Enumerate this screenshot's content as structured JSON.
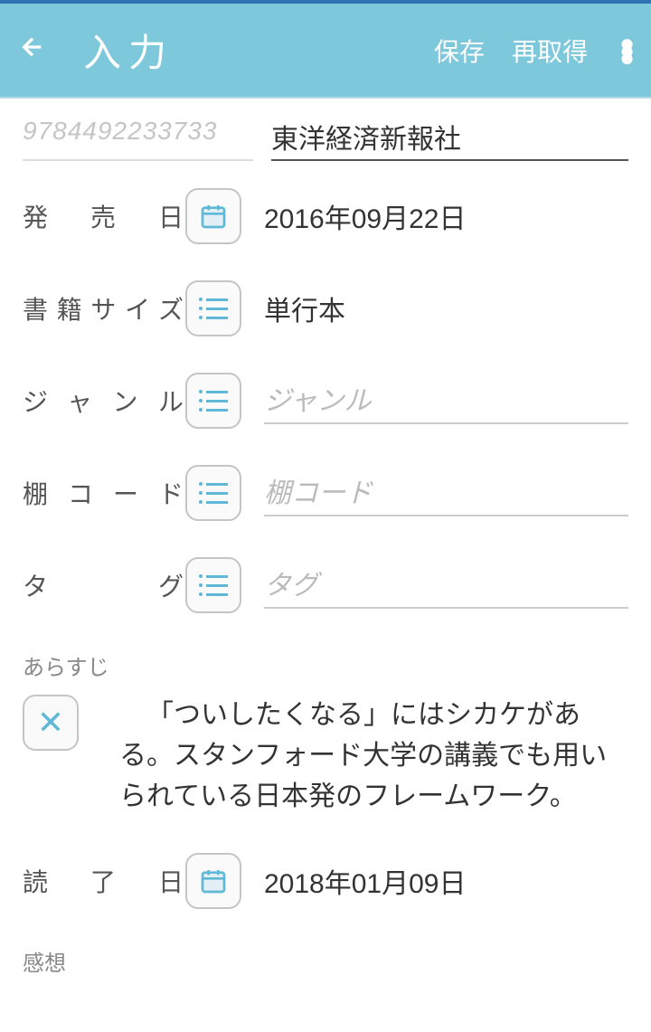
{
  "header": {
    "title": "入力",
    "save": "保存",
    "reload": "再取得"
  },
  "top": {
    "isbn": "9784492233733",
    "publisher": "東洋経済新報社"
  },
  "rows": {
    "release_date": {
      "label": "発売日",
      "value": "2016年09月22日"
    },
    "book_size": {
      "label": "書籍サイズ",
      "value": "単行本"
    },
    "genre": {
      "label": "ジャンル",
      "placeholder": "ジャンル"
    },
    "shelf_code": {
      "label": "棚コード",
      "placeholder": "棚コード"
    },
    "tag": {
      "label": "タグ",
      "placeholder": "タグ"
    },
    "finish_date": {
      "label": "読了日",
      "value": "2018年01月09日"
    }
  },
  "synopsis": {
    "label": "あらすじ",
    "text": "「ついしたくなる」にはシカケがある。スタンフォード大学の講義でも用いられている日本発のフレームワーク。"
  },
  "review": {
    "label": "感想"
  }
}
